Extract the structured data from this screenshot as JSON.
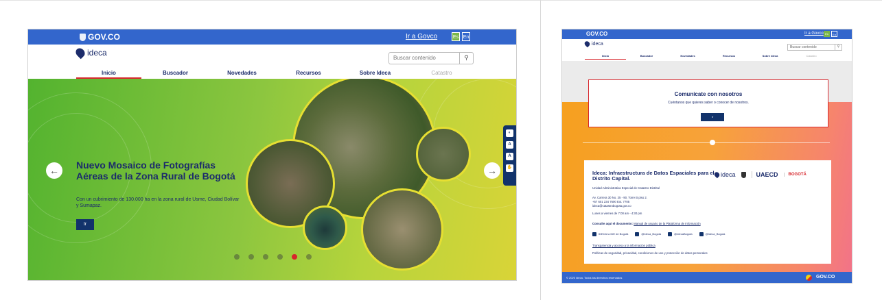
{
  "left": {
    "gov_logo": "GOV.CO",
    "gov_link": "Ir a Govco",
    "lang_es": "Es",
    "lang_en": "En",
    "brand": "ideca",
    "search_placeholder": "Buscar contenido",
    "search_icon": "search-icon",
    "nav": [
      "Inicio",
      "Buscador",
      "Novedades",
      "Recursos",
      "Sobre Ideca",
      "Catastro"
    ],
    "hero_title": "Nuevo Mosaico de Fotografías Aéreas de la Zona Rural de Bogotá",
    "hero_sub": "Con un cubrimiento de 130.000 ha en la zona rural de Usme, Ciudad Bolívar y Sumapaz.",
    "hero_button": "Ir",
    "slide_count": 6,
    "active_slide": 5
  },
  "right": {
    "gov_logo": "GOV.CO",
    "gov_link": "Ir a Govco",
    "lang_es": "Es",
    "lang_en": "En",
    "brand": "ideca",
    "search_placeholder": "Buscar contenido",
    "nav": [
      "Inicio",
      "Buscador",
      "Novedades",
      "Recursos",
      "Sobre Ideca",
      "Catastro"
    ],
    "contact_title": "Comunícate con nosotros",
    "contact_sub": "Cuéntanos que quieres saber o conocer de nosotros.",
    "contact_button": "Ir",
    "info_title": "Ideca: Infraestructura de Datos Espaciales para el Distrito Capital.",
    "info_unit": "Unidad Administrativa Especial de Catastro Distrital",
    "address": "Av. Carrera 30 No. 25 - 90, Torre B piso 2.",
    "phone": "+57 601 234 7600 Ext. 7705",
    "email": "ideca@catastrobogota.gov.co",
    "hours": "Lunes a viernes de 7:00 am - 4:30 pm",
    "manual_prefix": "Consulte aquí el documento:",
    "manual_link": "Manual de usuario de la Plataforma de Información",
    "social": [
      "IDECA la IDE de Bogotá",
      "@Ideca_Bogota",
      "@IdecaBogota",
      "@Ideca_Bogota"
    ],
    "transparency": "Transparencia y acceso a la información pública",
    "policies": "Políticas de seguridad, privacidad, condiciones de uso y protección de datos personales",
    "footer_left": "© 2020 Ideca. Todos los derechos reservados",
    "footer_right": "GOV.CO",
    "logo_uaecd": "UAECD",
    "logo_bogota": "BOGOTÁ"
  },
  "colors": {
    "gov_blue": "#3366cc",
    "navy": "#12336b",
    "accent_red": "#d7262c",
    "hero_green": "#8cc63f",
    "orange": "#f6a01f"
  }
}
